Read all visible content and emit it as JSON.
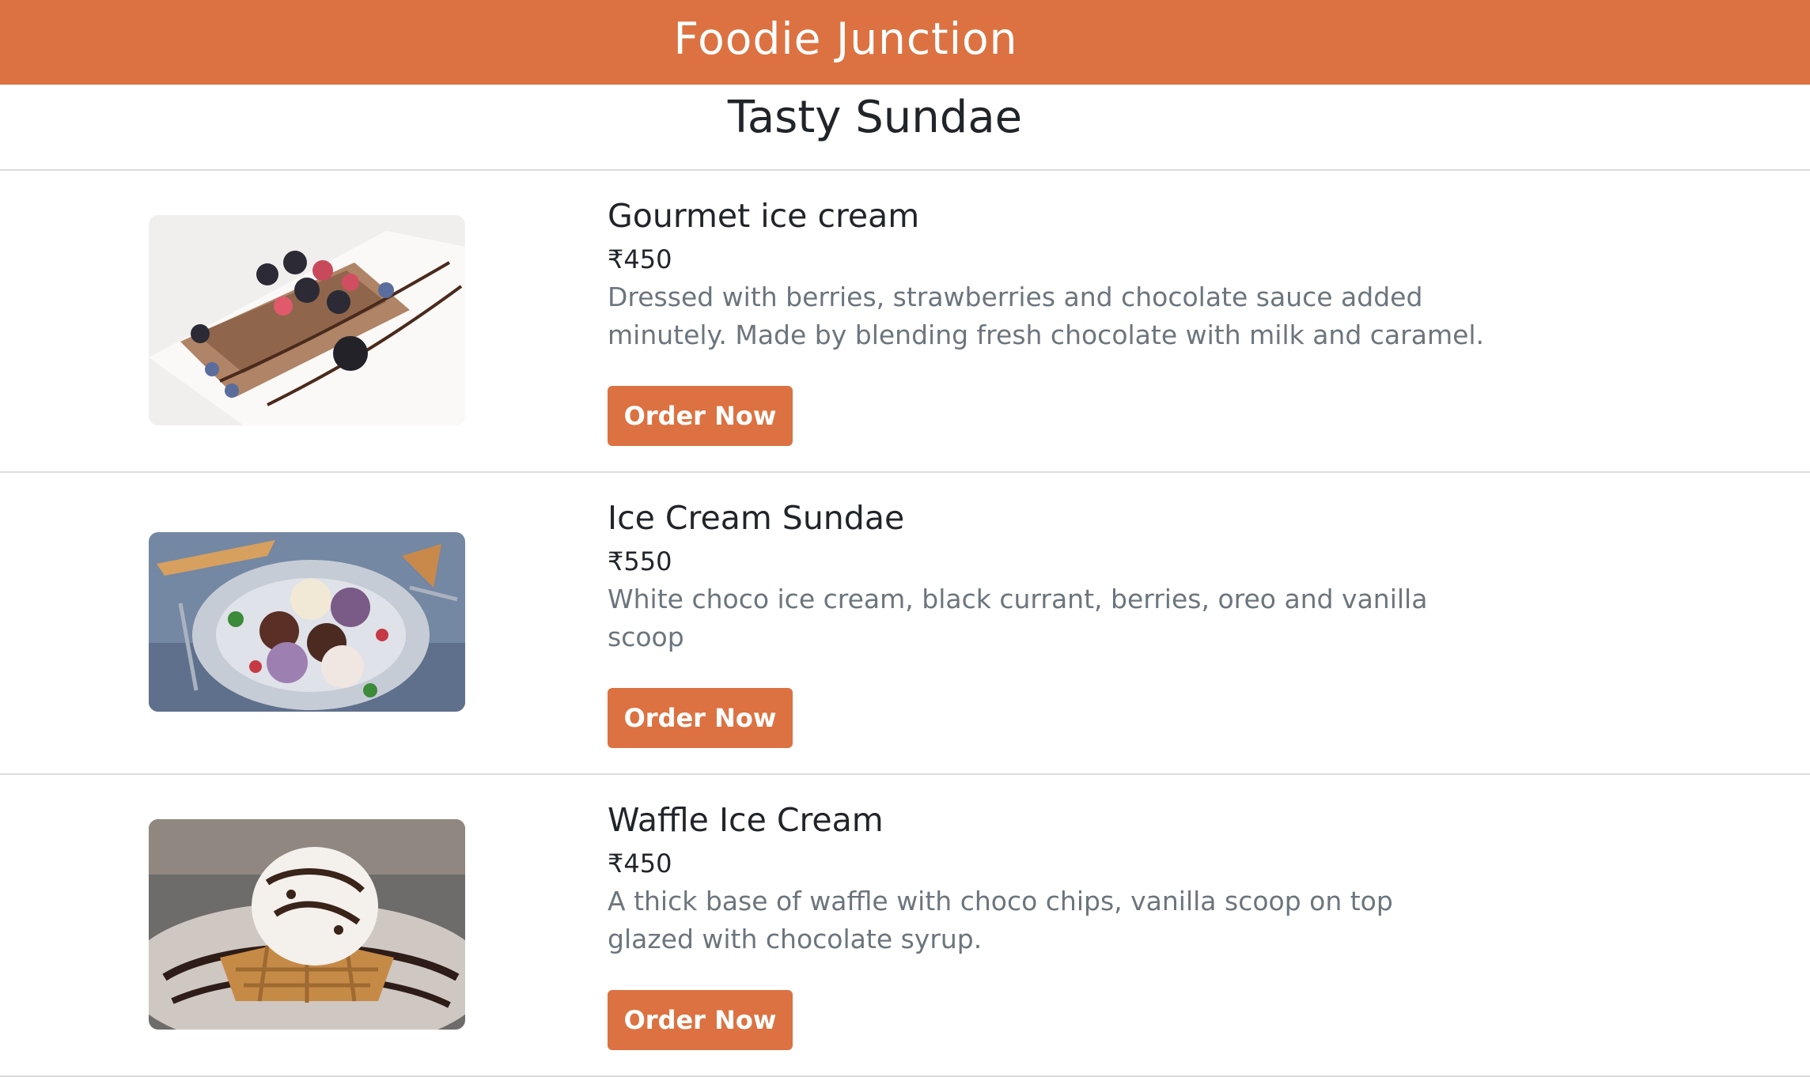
{
  "header": {
    "brand": "Foodie Junction"
  },
  "page": {
    "title": "Tasty Sundae"
  },
  "items": [
    {
      "title": "Gourmet ice cream",
      "price": "₹450",
      "description": "Dressed with berries, strawberries and chocolate sauce added minutely. Made by blending fresh chocolate with milk and caramel.",
      "button_label": "Order Now"
    },
    {
      "title": "Ice Cream Sundae",
      "price": "₹550",
      "description": "White choco ice cream, black currant, berries, oreo and vanilla scoop",
      "button_label": "Order Now"
    },
    {
      "title": "Waffle Ice Cream",
      "price": "₹450",
      "description": "A thick base of waffle with choco chips, vanilla scoop on top glazed with chocolate syrup.",
      "button_label": "Order Now"
    }
  ],
  "colors": {
    "accent": "#dc7241",
    "text": "#212529",
    "muted": "#6c757d",
    "divider": "#dcdcdc"
  }
}
